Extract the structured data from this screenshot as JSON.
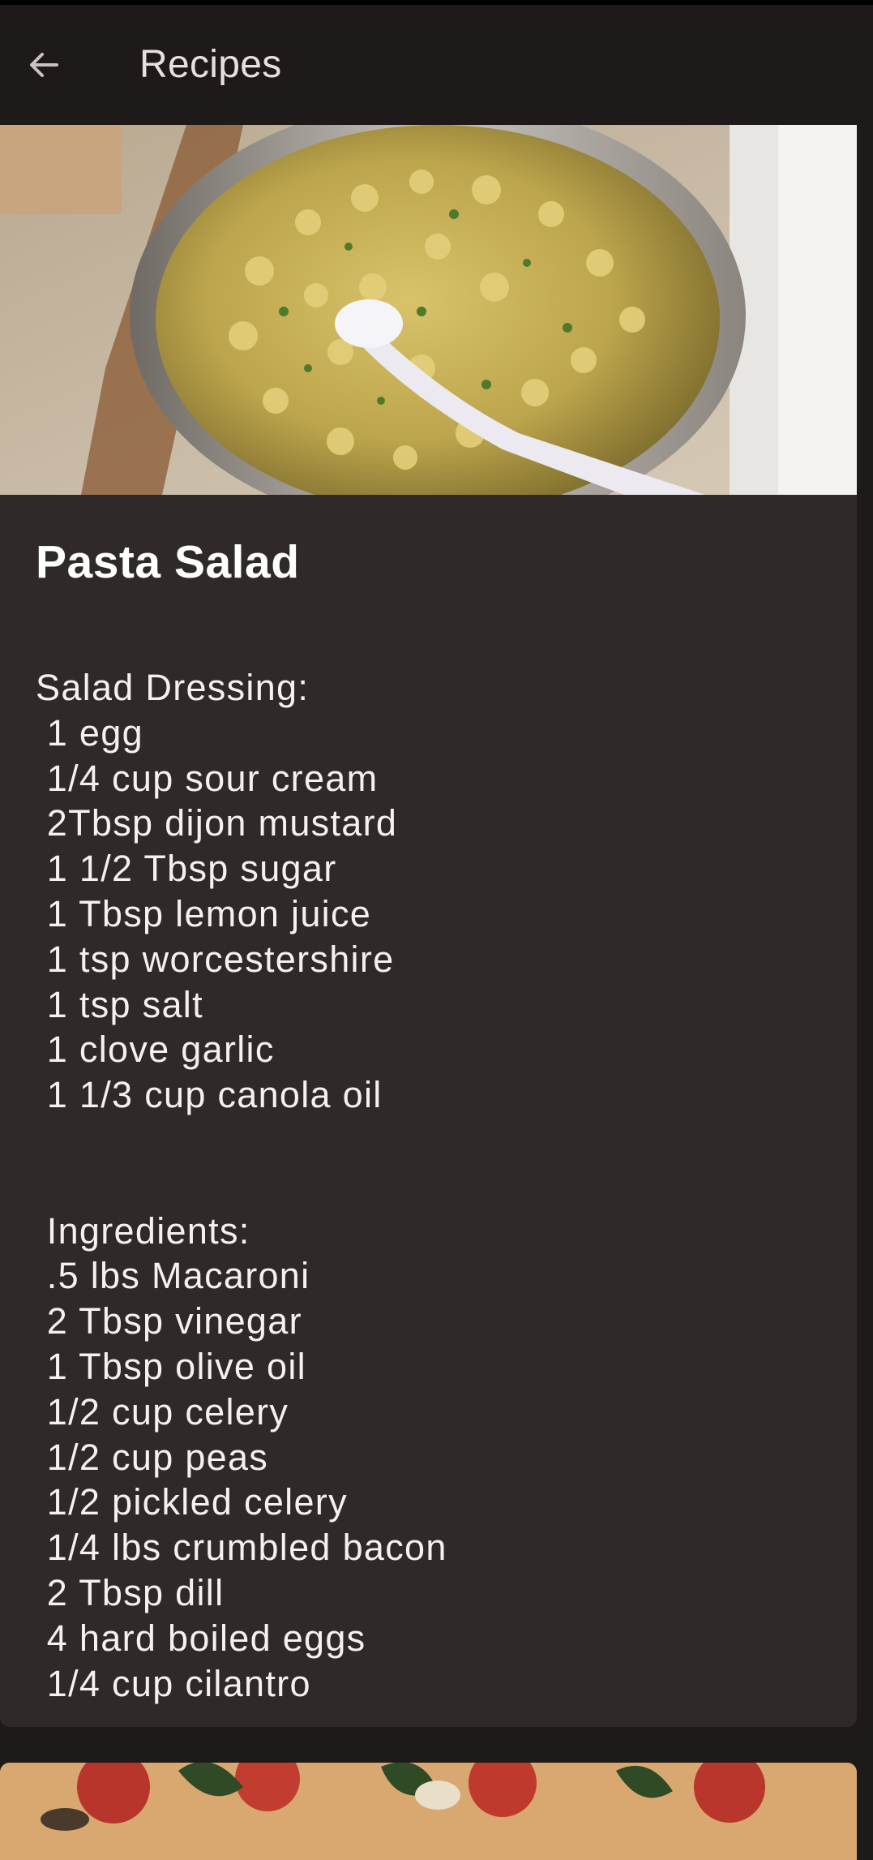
{
  "app_bar": {
    "title": "Recipes",
    "back_icon": "arrow-left-icon"
  },
  "recipe_card": {
    "title": "Pasta Salad",
    "image_subject": "pasta-salad-bowl",
    "body": "Salad Dressing:\n 1 egg\n 1/4 cup sour cream\n 2Tbsp dijon mustard\n 1 1/2 Tbsp sugar\n 1 Tbsp lemon juice\n 1 tsp worcestershire\n 1 tsp salt\n 1 clove garlic\n 1 1/3 cup canola oil\n\n\n Ingredients:\n .5 lbs Macaroni\n 2 Tbsp vinegar\n 1 Tbsp olive oil\n 1/2 cup celery\n 1/2 cup peas\n 1/2 pickled celery\n 1/4 lbs crumbled bacon\n 2 Tbsp dill\n 4 hard boiled eggs\n 1/4 cup cilantro"
  },
  "next_card": {
    "image_subject": "pizza"
  },
  "colors": {
    "background": "#1e1a19",
    "card": "#2f2a28",
    "title_text": "#ffffff",
    "body_text": "#f5f1ef"
  }
}
